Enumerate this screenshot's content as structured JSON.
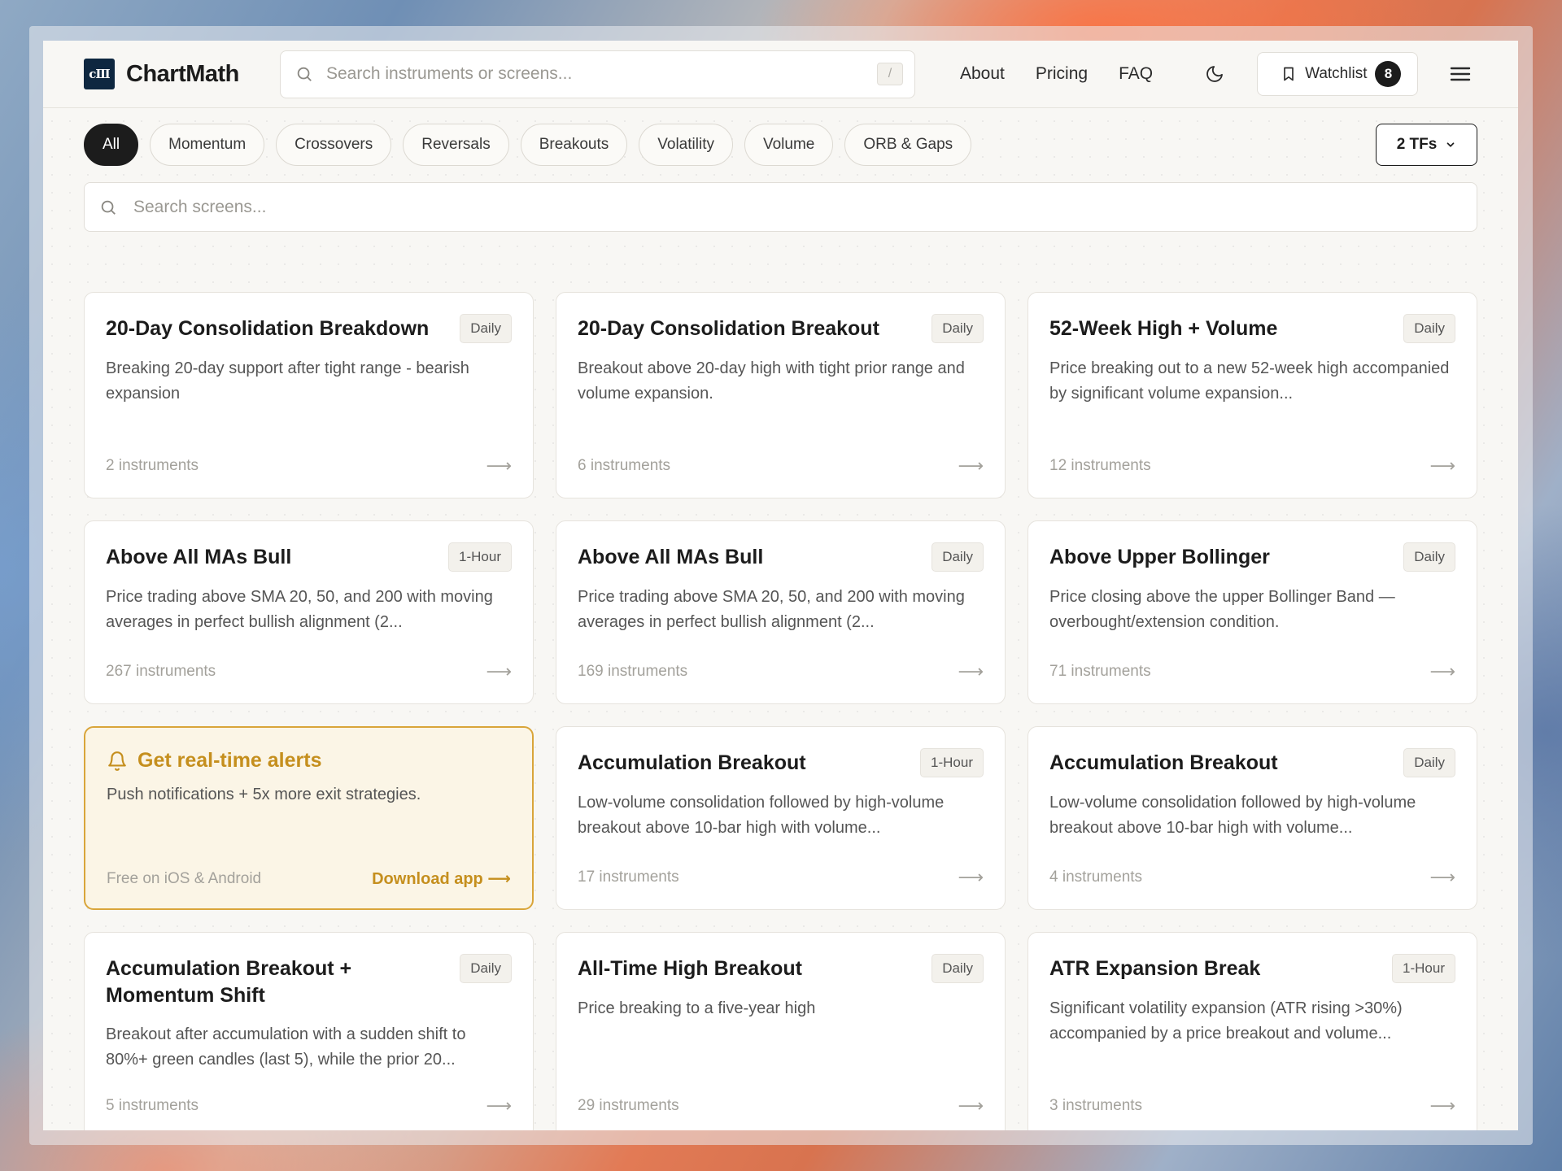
{
  "app": {
    "logo_mark": "cⅢ",
    "name": "ChartMath"
  },
  "header": {
    "search_placeholder": "Search instruments or screens...",
    "search_shortcut": "/",
    "nav": [
      "About",
      "Pricing",
      "FAQ"
    ],
    "watchlist_label": "Watchlist",
    "watchlist_count": "8"
  },
  "filters": {
    "chips": [
      "All",
      "Momentum",
      "Crossovers",
      "Reversals",
      "Breakouts",
      "Volatility",
      "Volume",
      "ORB & Gaps"
    ],
    "active": "All",
    "timeframe_select": "2 TFs",
    "screen_search_placeholder": "Search screens..."
  },
  "cards": [
    {
      "title": "20-Day Consolidation Breakdown",
      "tf": "Daily",
      "desc": "Breaking 20-day support after tight range - bearish expansion",
      "count": "2 instruments"
    },
    {
      "title": "20-Day Consolidation Breakout",
      "tf": "Daily",
      "desc": "Breakout above 20-day high with tight prior range and volume expansion.",
      "count": "6 instruments"
    },
    {
      "title": "52-Week High + Volume",
      "tf": "Daily",
      "desc": "Price breaking out to a new 52-week high accompanied by significant volume expansion...",
      "count": "12 instruments"
    },
    {
      "title": "Above All MAs Bull",
      "tf": "1-Hour",
      "desc": "Price trading above SMA 20, 50, and 200 with moving averages in perfect bullish alignment (2...",
      "count": "267 instruments"
    },
    {
      "title": "Above All MAs Bull",
      "tf": "Daily",
      "desc": "Price trading above SMA 20, 50, and 200 with moving averages in perfect bullish alignment (2...",
      "count": "169 instruments"
    },
    {
      "title": "Above Upper Bollinger",
      "tf": "Daily",
      "desc": "Price closing above the upper Bollinger Band — overbought/extension condition.",
      "count": "71 instruments"
    },
    {
      "title": "Accumulation Breakout",
      "tf": "1-Hour",
      "desc": "Low-volume consolidation followed by high-volume breakout above 10-bar high with volume...",
      "count": "17 instruments"
    },
    {
      "title": "Accumulation Breakout",
      "tf": "Daily",
      "desc": "Low-volume consolidation followed by high-volume breakout above 10-bar high with volume...",
      "count": "4 instruments"
    },
    {
      "title": "Accumulation Breakout + Momentum Shift",
      "tf": "Daily",
      "desc": "Breakout after accumulation with a sudden shift to 80%+ green candles (last 5), while the prior 20...",
      "count": "5 instruments"
    },
    {
      "title": "All-Time High Breakout",
      "tf": "Daily",
      "desc": "Price breaking to a five-year high",
      "count": "29 instruments"
    },
    {
      "title": "ATR Expansion Break",
      "tf": "1-Hour",
      "desc": "Significant volatility expansion (ATR rising >30%) accompanied by a price breakout and volume...",
      "count": "3 instruments"
    }
  ],
  "promo": {
    "title": "Get real-time alerts",
    "desc": "Push notifications + 5x more exit strategies.",
    "note": "Free on iOS & Android",
    "cta": "Download app ⟶"
  },
  "icons": {
    "arrow": "⟶"
  },
  "colors": {
    "accent_gold": "#c58f1e",
    "dark": "#1c1c1c",
    "logo_bg": "#0e2740"
  }
}
